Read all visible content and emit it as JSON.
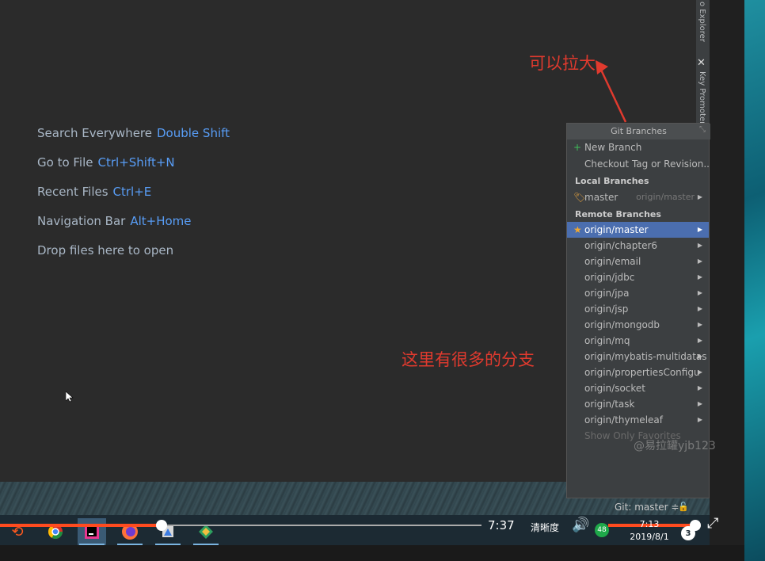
{
  "editor": {
    "hints": [
      {
        "label": "Search Everywhere",
        "key": "Double Shift"
      },
      {
        "label": "Go to File",
        "key": "Ctrl+Shift+N"
      },
      {
        "label": "Recent Files",
        "key": "Ctrl+E"
      },
      {
        "label": "Navigation Bar",
        "key": "Alt+Home"
      },
      {
        "label": "Drop files here to open",
        "key": ""
      }
    ]
  },
  "side_strip": {
    "top_tool": "o Explorer",
    "key_promoter": "Key Promoter"
  },
  "git_popup": {
    "title": "Git Branches",
    "new_branch": "New Branch",
    "checkout": "Checkout Tag or Revision...",
    "local_header": "Local Branches",
    "local": [
      {
        "name": "master",
        "tracking": "origin/master"
      }
    ],
    "remote_header": "Remote Branches",
    "remote": [
      "origin/master",
      "origin/chapter6",
      "origin/email",
      "origin/jdbc",
      "origin/jpa",
      "origin/jsp",
      "origin/mongodb",
      "origin/mq",
      "origin/mybatis-multidatas",
      "origin/propertiesConfigu",
      "origin/socket",
      "origin/task",
      "origin/thymeleaf"
    ],
    "favorites": "Show Only Favorites",
    "selected_index": 0
  },
  "annotations": {
    "top": "可以拉大",
    "middle": "这里有很多的分支",
    "watermark": "@易拉罐yjb123"
  },
  "status": {
    "git": "Git: master ≑"
  },
  "player": {
    "time": "7:37",
    "clarity": "清晰度",
    "progress": 0.33,
    "volume": 1.0
  },
  "tray": {
    "clock_time": "7:13",
    "clock_date": "2019/8/1",
    "badge_48": "48",
    "notifications": "3"
  },
  "colors": {
    "accent_blue": "#589df6",
    "selection": "#4b6eaf",
    "annotation_red": "#e03a2e",
    "progress_red": "#ff4b1f"
  }
}
